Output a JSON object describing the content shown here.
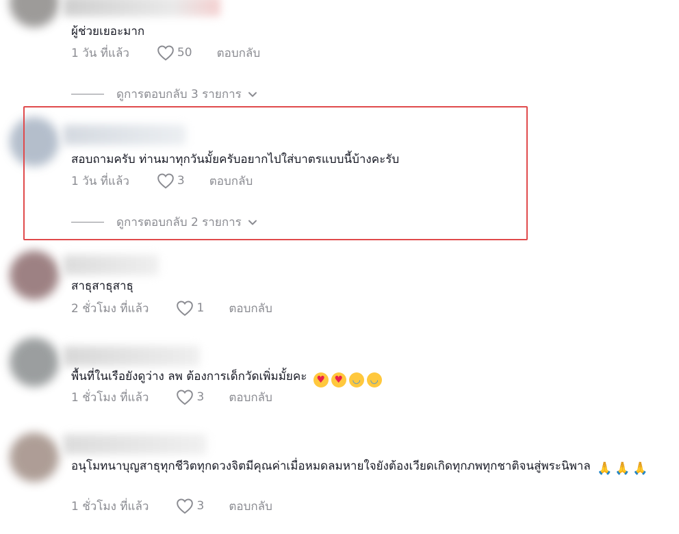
{
  "comments": [
    {
      "text": "ผู้ช่วยเยอะมาก",
      "time": "1 วัน ที่แล้ว",
      "likes": "50",
      "reply": "ตอบกลับ",
      "view_replies": "ดูการตอบกลับ 3 รายการ"
    },
    {
      "text": "สอบถามครับ ท่านมาทุกวันมั้ยครับอยากไปใส่บาตรแบบนี้บ้างคะรับ",
      "time": "1 วัน ที่แล้ว",
      "likes": "3",
      "reply": "ตอบกลับ",
      "view_replies": "ดูการตอบกลับ 2 รายการ"
    },
    {
      "text": "สาธุสาธุสาธุ",
      "time": "2 ชั่วโมง ที่แล้ว",
      "likes": "1",
      "reply": "ตอบกลับ"
    },
    {
      "text": "พื้นที่ในเรือยังดูว่าง ลพ ต้องการเด็กวัดเพิ่มมั้ยคะ",
      "emojis": [
        "smiling-face-with-heart-eyes",
        "smiling-face-with-heart-eyes",
        "face-with-tears-of-joy",
        "face-with-tears-of-joy"
      ],
      "time": "1 ชั่วโมง ที่แล้ว",
      "likes": "3",
      "reply": "ตอบกลับ"
    },
    {
      "text": "อนุโมทนาบุญสาธุทุกชีวิตทุกดวงจิตมีคุณค่าเมื่อหมดลมหายใจยังต้องเวียดเกิดทุกภพทุกชาติจนสู่พระนิพาล",
      "emojis": [
        "folded-hands",
        "folded-hands",
        "folded-hands"
      ],
      "time": "1 ชั่วโมง ที่แล้ว",
      "likes": "3",
      "reply": "ตอบกลับ"
    }
  ],
  "colors": {
    "text": "#161823",
    "muted": "#8a8b91",
    "highlight_border": "#e0494b"
  }
}
